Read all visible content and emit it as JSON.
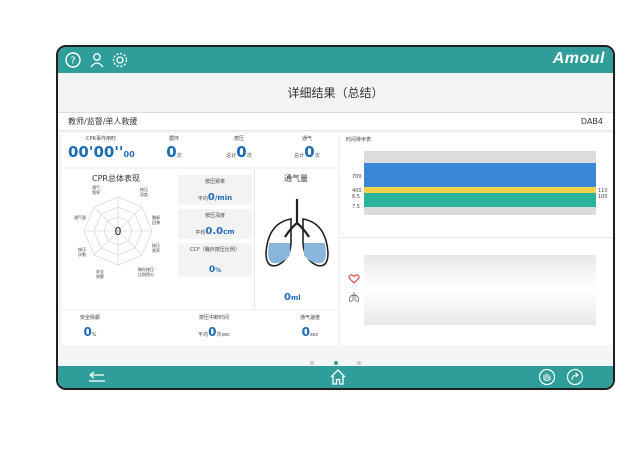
{
  "brand": "Amoul",
  "colors": {
    "teal": "#2f9e9a",
    "blue": "#1e6bb8",
    "band_blue": "#3a87d6",
    "band_yellow": "#f2d24a",
    "band_green": "#2ab39a"
  },
  "header": {
    "title": "详细结果（总结）",
    "mode": "教师/监督/单人救援",
    "device_id": "DAB4"
  },
  "stats": {
    "duration": {
      "label": "CPR事件用时",
      "value": "00'00''",
      "sub": "00"
    },
    "cycles": {
      "label": "循环",
      "value": "0",
      "unit": "次"
    },
    "compression": {
      "label": "按压",
      "prefix": "总计",
      "value": "0",
      "unit": "次"
    },
    "ventilation": {
      "label": "通气",
      "prefix": "总计",
      "value": "0",
      "unit": "次"
    }
  },
  "radar": {
    "title": "CPR总体表现",
    "score": "0",
    "labels": [
      "通气\n频率",
      "按压\n深度",
      "胸廓\n回弹",
      "按压\n频率",
      "胸外按压\n比例得分",
      "安全\n除颤",
      "按压\n次数",
      "通气量"
    ]
  },
  "cards": [
    {
      "title": "按压频率",
      "prefix": "平均",
      "value": "0",
      "unit": "/min"
    },
    {
      "title": "按压深度",
      "prefix": "平均",
      "value": "0.0",
      "unit": "cm"
    },
    {
      "title": "CCF（胸外按压比例）",
      "prefix": "",
      "value": "0",
      "unit": "%"
    }
  ],
  "lung": {
    "title": "通气量",
    "value": "0",
    "unit": "ml"
  },
  "timeline": {
    "title": "时间排序表",
    "left_ticks": [
      "700",
      "400",
      "6.5",
      "7.5"
    ],
    "right_ticks": [
      "110",
      "100"
    ]
  },
  "footer_stats": {
    "safe_defib": {
      "label": "安全除颤",
      "value": "0",
      "unit": "%"
    },
    "interrupt": {
      "label": "按压中断时间",
      "prefix": "平均",
      "value": "0",
      "unit": "次sec"
    },
    "vent_speed": {
      "label": "通气速度",
      "value": "0",
      "unit": "sec"
    }
  },
  "pager": {
    "pages": 3,
    "current": 2
  },
  "icons": [
    "help-icon",
    "person-icon",
    "settings-icon",
    "back-arrow-icon",
    "home-icon",
    "hand-icon",
    "share-icon",
    "heart-icon",
    "lung-icon"
  ]
}
